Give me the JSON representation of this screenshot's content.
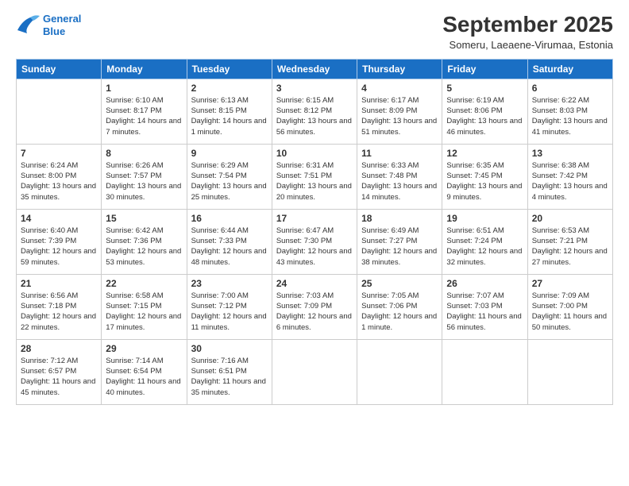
{
  "logo": {
    "line1": "General",
    "line2": "Blue"
  },
  "title": "September 2025",
  "location": "Someru, Laeaene-Virumaa, Estonia",
  "weekdays": [
    "Sunday",
    "Monday",
    "Tuesday",
    "Wednesday",
    "Thursday",
    "Friday",
    "Saturday"
  ],
  "weeks": [
    [
      {
        "day": null
      },
      {
        "day": "1",
        "sunrise": "6:10 AM",
        "sunset": "8:17 PM",
        "daylight": "14 hours and 7 minutes."
      },
      {
        "day": "2",
        "sunrise": "6:13 AM",
        "sunset": "8:15 PM",
        "daylight": "14 hours and 1 minute."
      },
      {
        "day": "3",
        "sunrise": "6:15 AM",
        "sunset": "8:12 PM",
        "daylight": "13 hours and 56 minutes."
      },
      {
        "day": "4",
        "sunrise": "6:17 AM",
        "sunset": "8:09 PM",
        "daylight": "13 hours and 51 minutes."
      },
      {
        "day": "5",
        "sunrise": "6:19 AM",
        "sunset": "8:06 PM",
        "daylight": "13 hours and 46 minutes."
      },
      {
        "day": "6",
        "sunrise": "6:22 AM",
        "sunset": "8:03 PM",
        "daylight": "13 hours and 41 minutes."
      }
    ],
    [
      {
        "day": "7",
        "sunrise": "6:24 AM",
        "sunset": "8:00 PM",
        "daylight": "13 hours and 35 minutes."
      },
      {
        "day": "8",
        "sunrise": "6:26 AM",
        "sunset": "7:57 PM",
        "daylight": "13 hours and 30 minutes."
      },
      {
        "day": "9",
        "sunrise": "6:29 AM",
        "sunset": "7:54 PM",
        "daylight": "13 hours and 25 minutes."
      },
      {
        "day": "10",
        "sunrise": "6:31 AM",
        "sunset": "7:51 PM",
        "daylight": "13 hours and 20 minutes."
      },
      {
        "day": "11",
        "sunrise": "6:33 AM",
        "sunset": "7:48 PM",
        "daylight": "13 hours and 14 minutes."
      },
      {
        "day": "12",
        "sunrise": "6:35 AM",
        "sunset": "7:45 PM",
        "daylight": "13 hours and 9 minutes."
      },
      {
        "day": "13",
        "sunrise": "6:38 AM",
        "sunset": "7:42 PM",
        "daylight": "13 hours and 4 minutes."
      }
    ],
    [
      {
        "day": "14",
        "sunrise": "6:40 AM",
        "sunset": "7:39 PM",
        "daylight": "12 hours and 59 minutes."
      },
      {
        "day": "15",
        "sunrise": "6:42 AM",
        "sunset": "7:36 PM",
        "daylight": "12 hours and 53 minutes."
      },
      {
        "day": "16",
        "sunrise": "6:44 AM",
        "sunset": "7:33 PM",
        "daylight": "12 hours and 48 minutes."
      },
      {
        "day": "17",
        "sunrise": "6:47 AM",
        "sunset": "7:30 PM",
        "daylight": "12 hours and 43 minutes."
      },
      {
        "day": "18",
        "sunrise": "6:49 AM",
        "sunset": "7:27 PM",
        "daylight": "12 hours and 38 minutes."
      },
      {
        "day": "19",
        "sunrise": "6:51 AM",
        "sunset": "7:24 PM",
        "daylight": "12 hours and 32 minutes."
      },
      {
        "day": "20",
        "sunrise": "6:53 AM",
        "sunset": "7:21 PM",
        "daylight": "12 hours and 27 minutes."
      }
    ],
    [
      {
        "day": "21",
        "sunrise": "6:56 AM",
        "sunset": "7:18 PM",
        "daylight": "12 hours and 22 minutes."
      },
      {
        "day": "22",
        "sunrise": "6:58 AM",
        "sunset": "7:15 PM",
        "daylight": "12 hours and 17 minutes."
      },
      {
        "day": "23",
        "sunrise": "7:00 AM",
        "sunset": "7:12 PM",
        "daylight": "12 hours and 11 minutes."
      },
      {
        "day": "24",
        "sunrise": "7:03 AM",
        "sunset": "7:09 PM",
        "daylight": "12 hours and 6 minutes."
      },
      {
        "day": "25",
        "sunrise": "7:05 AM",
        "sunset": "7:06 PM",
        "daylight": "12 hours and 1 minute."
      },
      {
        "day": "26",
        "sunrise": "7:07 AM",
        "sunset": "7:03 PM",
        "daylight": "11 hours and 56 minutes."
      },
      {
        "day": "27",
        "sunrise": "7:09 AM",
        "sunset": "7:00 PM",
        "daylight": "11 hours and 50 minutes."
      }
    ],
    [
      {
        "day": "28",
        "sunrise": "7:12 AM",
        "sunset": "6:57 PM",
        "daylight": "11 hours and 45 minutes."
      },
      {
        "day": "29",
        "sunrise": "7:14 AM",
        "sunset": "6:54 PM",
        "daylight": "11 hours and 40 minutes."
      },
      {
        "day": "30",
        "sunrise": "7:16 AM",
        "sunset": "6:51 PM",
        "daylight": "11 hours and 35 minutes."
      },
      {
        "day": null
      },
      {
        "day": null
      },
      {
        "day": null
      },
      {
        "day": null
      }
    ]
  ]
}
